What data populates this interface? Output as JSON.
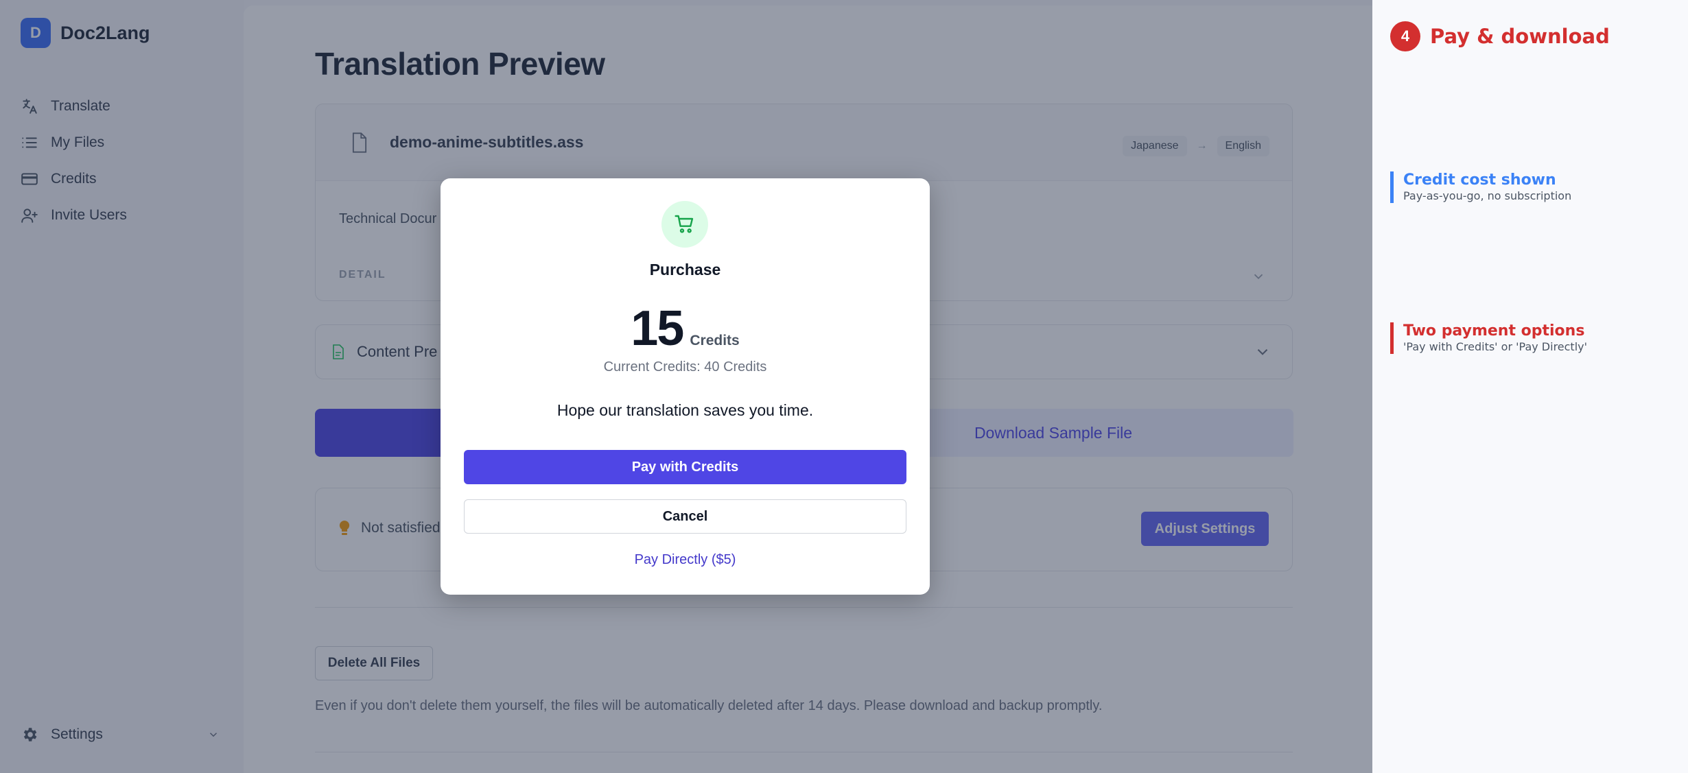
{
  "brand": {
    "logo_letter": "D",
    "name": "Doc2Lang"
  },
  "sidebar": {
    "items": [
      {
        "label": "Translate",
        "icon": "translate-icon"
      },
      {
        "label": "My Files",
        "icon": "list-icon"
      },
      {
        "label": "Credits",
        "icon": "credit-card-icon"
      },
      {
        "label": "Invite Users",
        "icon": "user-plus-icon"
      }
    ],
    "settings_label": "Settings"
  },
  "main": {
    "title": "Translation Preview",
    "file_name": "demo-anime-subtitles.ass",
    "source_lang": "Japanese",
    "target_lang": "English",
    "doc_type": "Technical Docur",
    "detail_label": "DETAIL",
    "content_preview_label": "Content Pre",
    "download_sample_label": "Download Sample File",
    "tip_text": "Not satisfied",
    "adjust_label": "Adjust Settings",
    "delete_label": "Delete All Files",
    "note": "Even if you don't delete them yourself, the files will be automatically deleted after 14 days. Please download and backup promptly."
  },
  "modal": {
    "title": "Purchase",
    "price_value": "15",
    "price_unit": "Credits",
    "current_credits": "Current Credits: 40 Credits",
    "message": "Hope our translation saves you time.",
    "pay_credits_label": "Pay with Credits",
    "cancel_label": "Cancel",
    "pay_direct_label": "Pay Directly ($5)"
  },
  "annotations": {
    "step_number": "4",
    "step_title": "Pay & download",
    "notes": [
      {
        "title": "Credit cost shown",
        "subtitle": "Pay-as-you-go, no subscription",
        "color": "#3b82f6"
      },
      {
        "title": "Two payment options",
        "subtitle": "'Pay with Credits' or 'Pay Directly'",
        "color": "#d32f2f"
      }
    ]
  },
  "colors": {
    "accent": "#4f46e5",
    "brand": "#3b6ff5",
    "annotation_red": "#d32f2f",
    "annotation_blue": "#3b82f6"
  }
}
